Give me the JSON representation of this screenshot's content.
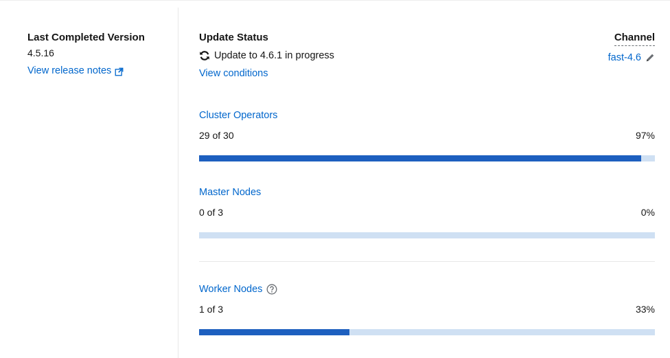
{
  "last_completed": {
    "label": "Last Completed Version",
    "version": "4.5.16",
    "release_notes_link": "View release notes",
    "external_icon": "external-link-icon"
  },
  "update_status": {
    "label": "Update Status",
    "status_text": "Update to 4.6.1 in progress",
    "status_icon": "sync-icon",
    "view_conditions": "View conditions"
  },
  "channel": {
    "label": "Channel",
    "value": "fast-4.6",
    "edit_icon": "pencil-icon"
  },
  "progress": [
    {
      "title": "Cluster Operators",
      "count": "29 of 30",
      "percent_label": "97%",
      "percent": 97,
      "has_help": false
    },
    {
      "title": "Master Nodes",
      "count": "0 of 3",
      "percent_label": "0%",
      "percent": 0,
      "has_help": false
    },
    {
      "title": "Worker Nodes",
      "count": "1 of 3",
      "percent_label": "33%",
      "percent": 33,
      "has_help": true,
      "help_icon": "question-circle-icon"
    }
  ],
  "colors": {
    "link": "#0066cc",
    "bar_fill": "#1d5fbf",
    "bar_track": "#cfe0f3"
  }
}
